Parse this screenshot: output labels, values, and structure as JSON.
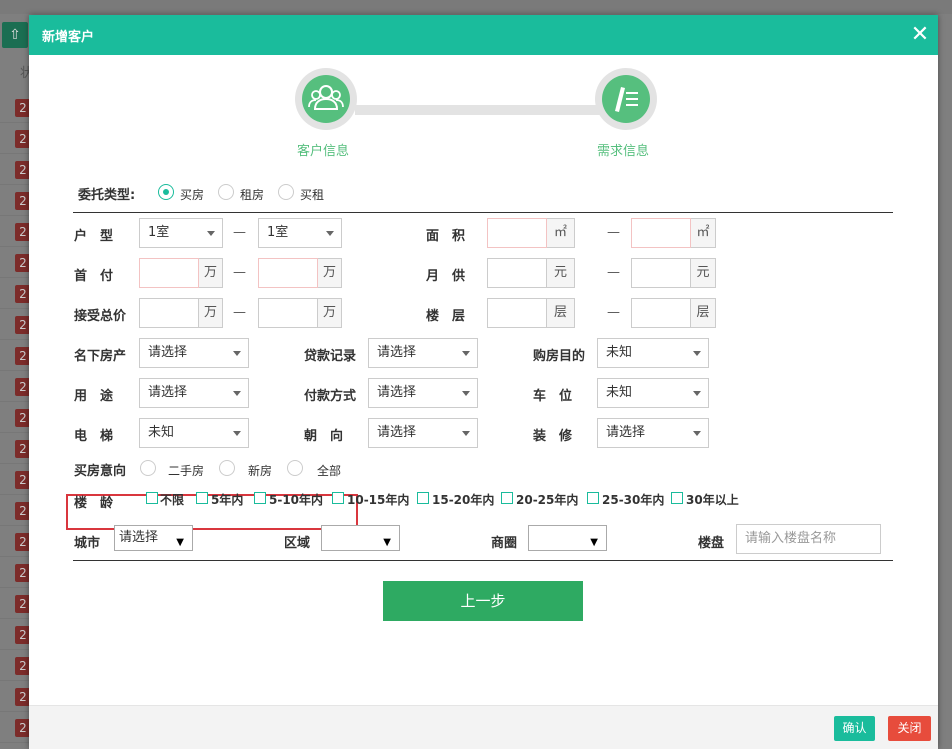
{
  "background": {
    "upload_icon": "upload-icon",
    "col_header": "状",
    "row_badge": "2",
    "row_count": 21
  },
  "modal": {
    "title": "新增客户",
    "close_glyph": "✕"
  },
  "steps": [
    {
      "label": "客户信息",
      "icon": "users-icon"
    },
    {
      "label": "需求信息",
      "icon": "edit-list-icon"
    }
  ],
  "entrust": {
    "label": "委托类型:",
    "options": [
      "买房",
      "租房",
      "买租"
    ],
    "selected": "买房"
  },
  "rows": {
    "layout": {
      "label": "户　型",
      "from": "1室",
      "to": "1室"
    },
    "area": {
      "label": "面　积",
      "unit": "㎡"
    },
    "downpay": {
      "label": "首　付",
      "unit": "万"
    },
    "monthly": {
      "label": "月　供",
      "unit": "元"
    },
    "total": {
      "label": "接受总价",
      "unit": "万"
    },
    "floor": {
      "label": "楼　层",
      "unit": "层"
    },
    "dash": "—"
  },
  "selects": {
    "property": {
      "label": "名下房产",
      "value": "请选择"
    },
    "loan": {
      "label": "贷款记录",
      "value": "请选择"
    },
    "purpose": {
      "label": "购房目的",
      "value": "未知"
    },
    "usage": {
      "label": "用　途",
      "value": "请选择"
    },
    "payment": {
      "label": "付款方式",
      "value": "请选择"
    },
    "parking": {
      "label": "车　位",
      "value": "未知"
    },
    "elevator": {
      "label": "电　梯",
      "value": "未知"
    },
    "orientation": {
      "label": "朝　向",
      "value": "请选择"
    },
    "decoration": {
      "label": "装　修",
      "value": "请选择"
    }
  },
  "intent": {
    "label": "买房意向",
    "options": [
      "二手房",
      "新房",
      "全部"
    ]
  },
  "age": {
    "label": "楼　龄",
    "options": [
      "不限",
      "5年内",
      "5-10年内",
      "10-15年内",
      "15-20年内",
      "20-25年内",
      "25-30年内",
      "30年以上"
    ]
  },
  "location": {
    "city_label": "城市",
    "city_value": "请选择",
    "district_label": "区域",
    "district_value": "",
    "circle_label": "商圈",
    "circle_value": "",
    "estate_label": "楼盘",
    "estate_placeholder": "请输入楼盘名称"
  },
  "buttons": {
    "prev": "上一步",
    "ok": "确认",
    "cancel": "关闭"
  },
  "colors": {
    "accent": "#1abc9c",
    "step": "#56bf7e",
    "primary_btn": "#2eaa62",
    "danger": "#e74c3c",
    "highlight": "#d9363e"
  }
}
